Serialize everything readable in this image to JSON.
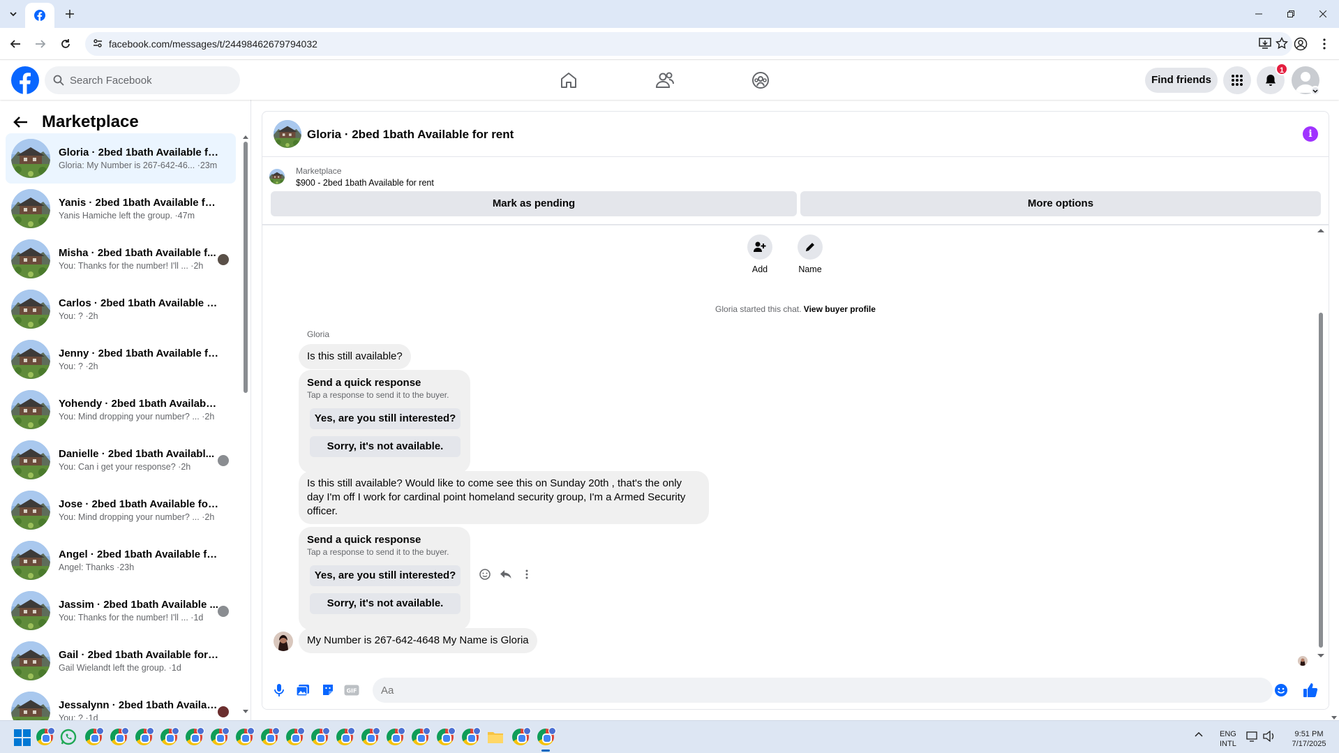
{
  "browser": {
    "url": "facebook.com/messages/t/24498462679794032"
  },
  "header": {
    "search_placeholder": "Search Facebook",
    "find_friends": "Find friends",
    "notif_count": "1"
  },
  "sidebar": {
    "title": "Marketplace",
    "conversations": [
      {
        "name": "Gloria · 2bed 1bath Available for...",
        "preview": "Gloria: My Number is 267-642-46... ·23m",
        "active": true
      },
      {
        "name": "Yanis · 2bed 1bath Available for r...",
        "preview": "Yanis Hamiche left the group. ·47m"
      },
      {
        "name": "Misha · 2bed 1bath Available f...",
        "preview": "You: Thanks for the number! I'll ... ·2h"
      },
      {
        "name": "Carlos · 2bed 1bath Available for...",
        "preview": "You: ? ·2h"
      },
      {
        "name": "Jenny · 2bed 1bath Available for ...",
        "preview": "You: ? ·2h"
      },
      {
        "name": "Yohendy · 2bed 1bath Available f...",
        "preview": "You: Mind dropping your number? ... ·2h"
      },
      {
        "name": "Danielle · 2bed 1bath Availabl...",
        "preview": "You: Can i get your response? ·2h"
      },
      {
        "name": "Jose · 2bed 1bath Available for r...",
        "preview": "You: Mind dropping your number? ... ·2h"
      },
      {
        "name": "Angel · 2bed 1bath Available for ...",
        "preview": "Angel: Thanks ·23h"
      },
      {
        "name": "Jassim · 2bed 1bath Available ...",
        "preview": "You: Thanks for the number! I'll ... ·1d"
      },
      {
        "name": "Gail · 2bed 1bath Available for re...",
        "preview": "Gail Wielandt left the group. ·1d"
      },
      {
        "name": "Jessalynn · 2bed 1bath Availab...",
        "preview": "You: ? ·1d"
      }
    ]
  },
  "chat": {
    "title": "Gloria · 2bed 1bath Available for rent",
    "marketplace_label": "Marketplace",
    "listing": "$900 - 2bed 1bath Available for rent",
    "mark_pending": "Mark as pending",
    "more_options": "More options",
    "add_label": "Add",
    "name_label": "Name",
    "started_text": "Gloria started this chat.",
    "view_profile": "View buyer profile",
    "sender": "Gloria",
    "msg1": "Is this still available?",
    "quick_title": "Send a quick response",
    "quick_sub": "Tap a response to send it to the buyer.",
    "quick_yes": "Yes, are you still interested?",
    "quick_no": "Sorry, it's not available.",
    "msg2": "Is this still available? Would like to come see this on Sunday 20th , that's the only day I'm off I work for cardinal point homeland security group, I'm a Armed Security officer.",
    "msg3": "My Number is 267-642-4648  My Name is Gloria",
    "composer_placeholder": "Aa"
  },
  "taskbar": {
    "lang": "ENG",
    "layout": "INTL",
    "time": "9:51 PM",
    "date": "7/17/2025"
  }
}
